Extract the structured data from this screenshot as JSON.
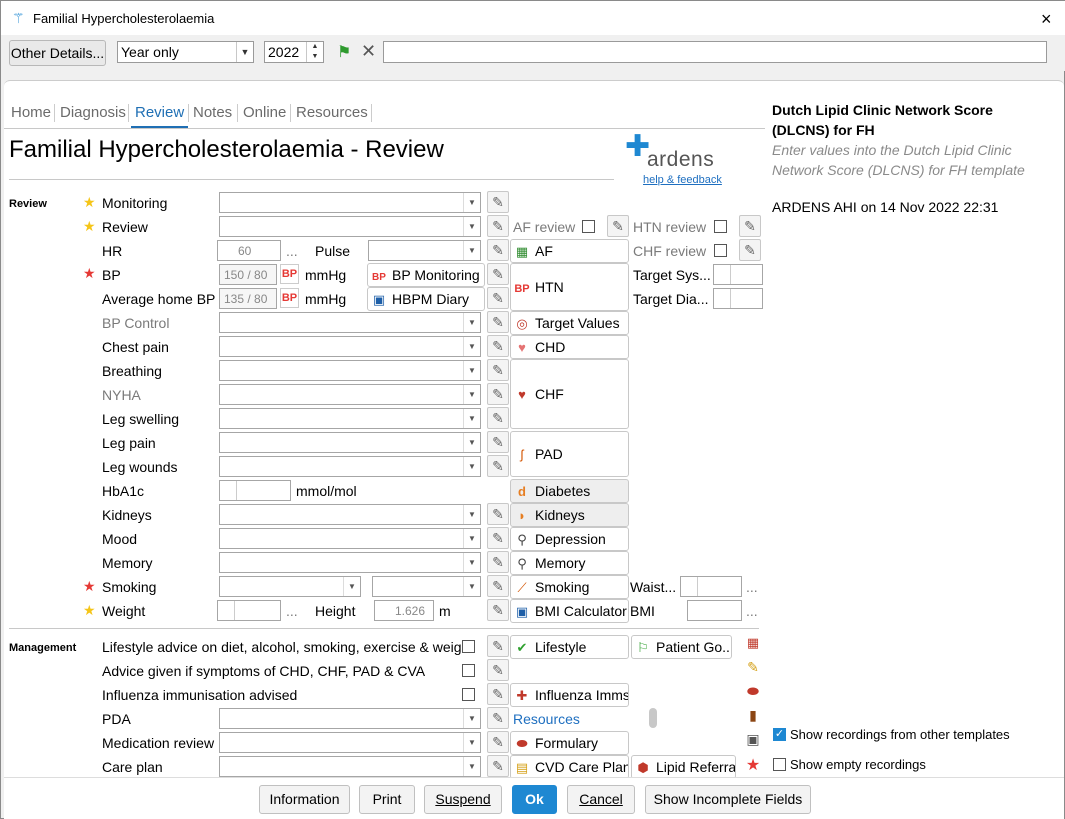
{
  "window": {
    "title": "Familial Hypercholesterolaemia",
    "close": "×"
  },
  "toolbar": {
    "other_details": "Other Details...",
    "period": "Year only",
    "year": "2022",
    "note": ""
  },
  "tabs": [
    "Home",
    "Diagnosis",
    "Review",
    "Notes",
    "Online",
    "Resources"
  ],
  "header": {
    "title": "Familial Hypercholesterolaemia - Review",
    "logo": "ardens",
    "feedback": "help & feedback"
  },
  "sections": {
    "review": "Review",
    "management": "Management"
  },
  "rows": {
    "monitoring": "Monitoring",
    "review": "Review",
    "hr": "HR",
    "hr_value": "60",
    "hr_ellipsis": "...",
    "pulse": "Pulse",
    "bp": "BP",
    "bp_value": "150 / 80",
    "bp_unit": "mmHg",
    "avg_bp": "Average home BP",
    "avg_bp_value": "135 / 80",
    "bp_control": "BP Control",
    "chest_pain": "Chest pain",
    "breathing": "Breathing",
    "nyha": "NYHA",
    "leg_swelling": "Leg swelling",
    "leg_pain": "Leg pain",
    "leg_wounds": "Leg wounds",
    "hba1c": "HbA1c",
    "hba1c_unit": "mmol/mol",
    "kidneys": "Kidneys",
    "mood": "Mood",
    "memory": "Memory",
    "smoking": "Smoking",
    "weight": "Weight",
    "weight_ellipsis": "...",
    "height": "Height",
    "height_value": "1.626",
    "height_unit": "m",
    "waist": "Waist...",
    "waist_ellipsis": "...",
    "bmi": "BMI",
    "lifestyle_advice": "Lifestyle advice on diet, alcohol, smoking, exercise & weight",
    "advice_symptoms": "Advice given if symptoms of CHD, CHF, PAD & CVA",
    "influenza": "Influenza immunisation advised",
    "pda": "PDA",
    "med_review": "Medication review",
    "care_plan": "Care plan"
  },
  "side": {
    "af_review": "AF review",
    "htn_review": "HTN review",
    "chf_review": "CHF review",
    "target_sys": "Target Sys...",
    "target_dia": "Target Dia..."
  },
  "buttons": {
    "bp_monitoring": "BP Monitoring",
    "hbpm_diary": "HBPM Diary",
    "af": "AF",
    "htn": "HTN",
    "target_values": "Target Values",
    "chd": "CHD",
    "chf": "CHF",
    "pad": "PAD",
    "diabetes": "Diabetes",
    "kidneys": "Kidneys",
    "depression": "Depression",
    "memory": "Memory",
    "smoking": "Smoking",
    "bmi_calc": "BMI Calculator",
    "lifestyle": "Lifestyle",
    "patient_goals": "Patient Go...",
    "influenza_imms": "Influenza Imms",
    "resources": "Resources",
    "formulary": "Formulary",
    "cvd_care_plan": "CVD Care Plan",
    "lipid_referral": "Lipid Referral"
  },
  "right_panel": {
    "title": "Dutch Lipid Clinic Network Score (DLCNS) for FH",
    "desc": "Enter values into the Dutch Lipid Clinic Network Score (DLCNS) for FH template",
    "recorded": "ARDENS AHI on 14 Nov 2022 22:31",
    "show_other": "Show recordings from other templates",
    "show_empty": "Show empty recordings"
  },
  "footer": [
    "Information",
    "Print",
    "Suspend",
    "Ok",
    "Cancel",
    "Show Incomplete Fields"
  ],
  "colors": {
    "accent": "#1e88d2",
    "star_gold": "#f5c518",
    "star_red": "#e53935",
    "bp_red": "#e53935"
  }
}
